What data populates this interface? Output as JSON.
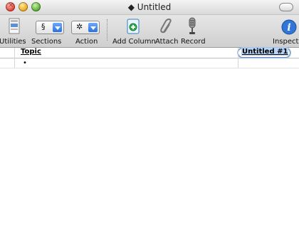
{
  "window": {
    "title": "Untitled",
    "title_marker": "◆"
  },
  "toolbar": {
    "utilities_label": "Utilities",
    "sections_label": "Sections",
    "sections_symbol": "§",
    "action_label": "Action",
    "action_symbol": "✲",
    "add_column_label": "Add Column",
    "attach_label": "Attach",
    "record_label": "Record",
    "inspect_label": "Inspect"
  },
  "outline": {
    "topic_header": "Topic",
    "column_title": "Untitled #1",
    "row_bullet": "•"
  }
}
